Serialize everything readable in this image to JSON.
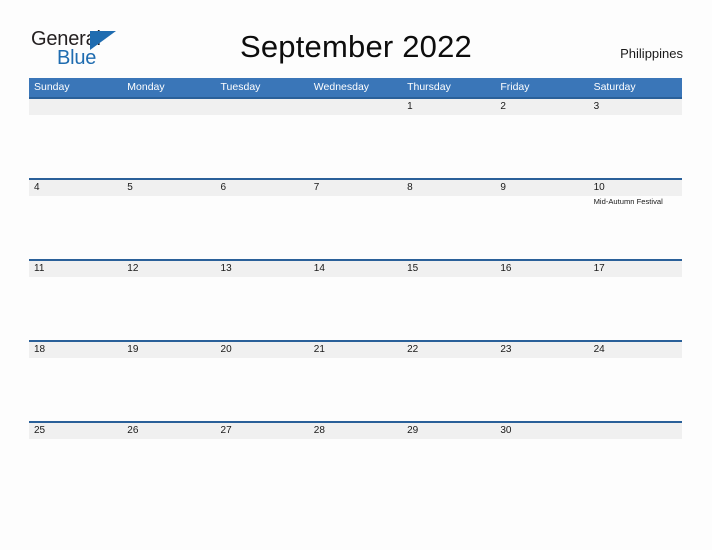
{
  "logo": {
    "text_top": "General",
    "text_bottom": "Blue",
    "triangle_icon": "triangle-icon",
    "brand_color": "#1f6cb0"
  },
  "header": {
    "title": "September 2022",
    "country": "Philippines"
  },
  "calendar": {
    "header_background": "#3a76b8",
    "row_rule_color": "#2a6099",
    "row_band_color": "#f0f0f0",
    "weekdays": [
      "Sunday",
      "Monday",
      "Tuesday",
      "Wednesday",
      "Thursday",
      "Friday",
      "Saturday"
    ],
    "weeks": [
      [
        {
          "day": "",
          "events": []
        },
        {
          "day": "",
          "events": []
        },
        {
          "day": "",
          "events": []
        },
        {
          "day": "",
          "events": []
        },
        {
          "day": "1",
          "events": []
        },
        {
          "day": "2",
          "events": []
        },
        {
          "day": "3",
          "events": []
        }
      ],
      [
        {
          "day": "4",
          "events": []
        },
        {
          "day": "5",
          "events": []
        },
        {
          "day": "6",
          "events": []
        },
        {
          "day": "7",
          "events": []
        },
        {
          "day": "8",
          "events": []
        },
        {
          "day": "9",
          "events": []
        },
        {
          "day": "10",
          "events": [
            "Mid-Autumn Festival"
          ]
        }
      ],
      [
        {
          "day": "11",
          "events": []
        },
        {
          "day": "12",
          "events": []
        },
        {
          "day": "13",
          "events": []
        },
        {
          "day": "14",
          "events": []
        },
        {
          "day": "15",
          "events": []
        },
        {
          "day": "16",
          "events": []
        },
        {
          "day": "17",
          "events": []
        }
      ],
      [
        {
          "day": "18",
          "events": []
        },
        {
          "day": "19",
          "events": []
        },
        {
          "day": "20",
          "events": []
        },
        {
          "day": "21",
          "events": []
        },
        {
          "day": "22",
          "events": []
        },
        {
          "day": "23",
          "events": []
        },
        {
          "day": "24",
          "events": []
        }
      ],
      [
        {
          "day": "25",
          "events": []
        },
        {
          "day": "26",
          "events": []
        },
        {
          "day": "27",
          "events": []
        },
        {
          "day": "28",
          "events": []
        },
        {
          "day": "29",
          "events": []
        },
        {
          "day": "30",
          "events": []
        },
        {
          "day": "",
          "events": []
        }
      ]
    ]
  }
}
